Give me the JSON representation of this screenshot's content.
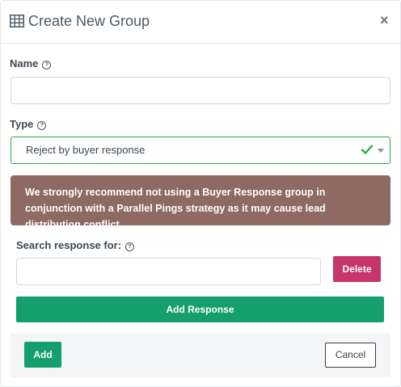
{
  "dialog": {
    "title": "Create New Group",
    "close_label": "×"
  },
  "form": {
    "name_label": "Name",
    "name_value": "",
    "type_label": "Type",
    "type_value": "Reject by buyer response",
    "help_glyph": "?",
    "alert_text": "We strongly recommend not using a Buyer Response group in conjunction with a Parallel Pings strategy as it may cause lead distribution conflict.",
    "search_label": "Search response for:",
    "search_value": "",
    "delete_label": "Delete",
    "add_response_label": "Add Response"
  },
  "footer": {
    "add_label": "Add",
    "cancel_label": "Cancel"
  },
  "colors": {
    "primary_green": "#159f6e",
    "delete_pink": "#c6356b",
    "alert_brown": "#8e6a62",
    "valid_green": "#2aa84a"
  },
  "icons": {
    "title": "table-icon",
    "close": "close-icon",
    "help": "help-circle-icon",
    "valid": "checkmark-icon",
    "dropdown": "caret-down-icon"
  }
}
